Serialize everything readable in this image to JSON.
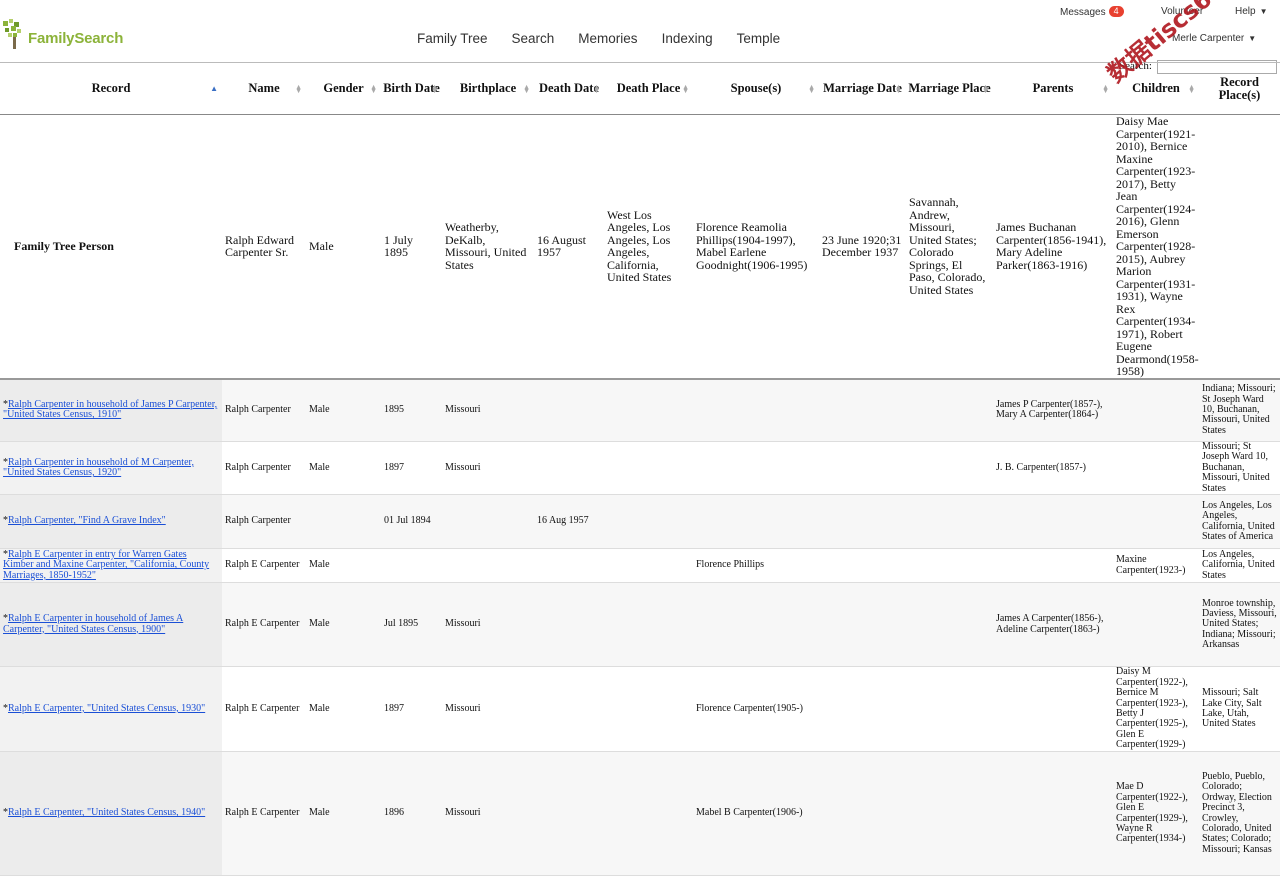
{
  "header": {
    "logo_text": "FamilySearch",
    "nav": [
      "Family Tree",
      "Search",
      "Memories",
      "Indexing",
      "Temple"
    ],
    "messages_label": "Messages",
    "messages_count": "4",
    "volunteer_label": "Volunteer",
    "help_label": "Help",
    "user_name": "Merle Carpenter",
    "search_label": "Search:",
    "search_value": ""
  },
  "watermark": "数据tiscs66",
  "columns": [
    "Record",
    "Name",
    "Gender",
    "Birth Date",
    "Birthplace",
    "Death Date",
    "Death Place",
    "Spouse(s)",
    "Marriage Date",
    "Marriage Place",
    "Parents",
    "Children",
    "Record Place(s)"
  ],
  "person": {
    "record": "Family Tree Person",
    "name": "Ralph Edward Carpenter Sr.",
    "gender": "Male",
    "birth_date": "1 July 1895",
    "birthplace": "Weatherby, DeKalb, Missouri, United States",
    "death_date": "16 August 1957",
    "death_place": "West Los Angeles, Los Angeles, Los Angeles, California, United States",
    "spouses": "Florence Reamolia Phillips(1904-1997), Mabel Earlene Goodnight(1906-1995)",
    "marriage_date": "23 June 1920;31 December 1937",
    "marriage_place": "Savannah, Andrew, Missouri, United States; Colorado Springs, El Paso, Colorado, United States",
    "parents": "James Buchanan Carpenter(1856-1941), Mary Adeline Parker(1863-1916)",
    "children": "Daisy Mae Carpenter(1921-2010), Bernice Maxine Carpenter(1923-2017), Betty Jean Carpenter(1924-2016), Glenn Emerson Carpenter(1928-2015), Aubrey Marion Carpenter(1931-1931), Wayne Rex Carpenter(1934-1971), Robert Eugene Dearmond(1958-1958)",
    "record_places": ""
  },
  "rows": [
    {
      "star": "*",
      "record": "Ralph Carpenter in household of James P Carpenter, \"United States Census, 1910\"",
      "name": "Ralph Carpenter",
      "gender": "Male",
      "birth_date": "1895",
      "birthplace": "Missouri",
      "death_date": "",
      "death_place": "",
      "spouses": "",
      "marriage_date": "",
      "marriage_place": "",
      "parents": "James P Carpenter(1857-), Mary A Carpenter(1864-)",
      "children": "",
      "record_places": "Indiana; Missouri; St Joseph Ward 10, Buchanan, Missouri, United States"
    },
    {
      "star": "*",
      "record": "Ralph Carpenter in household of M Carpenter, \"United States Census, 1920\"",
      "name": "Ralph Carpenter",
      "gender": "Male",
      "birth_date": "1897",
      "birthplace": "Missouri",
      "death_date": "",
      "death_place": "",
      "spouses": "",
      "marriage_date": "",
      "marriage_place": "",
      "parents": "J. B. Carpenter(1857-)",
      "children": "",
      "record_places": "Missouri; St Joseph Ward 10, Buchanan, Missouri, United States"
    },
    {
      "star": "*",
      "record": "Ralph Carpenter, \"Find A Grave Index\"",
      "name": "Ralph Carpenter",
      "gender": "",
      "birth_date": "01 Jul 1894",
      "birthplace": "",
      "death_date": "16 Aug 1957",
      "death_place": "",
      "spouses": "",
      "marriage_date": "",
      "marriage_place": "",
      "parents": "",
      "children": "",
      "record_places": "Los Angeles, Los Angeles, California, United States of America"
    },
    {
      "star": "*",
      "record": "Ralph E Carpenter in entry for Warren Gates Kimber and Maxine Carpenter, \"California, County Marriages, 1850-1952\"",
      "name": "Ralph E Carpenter",
      "gender": "Male",
      "birth_date": "",
      "birthplace": "",
      "death_date": "",
      "death_place": "",
      "spouses": "Florence Phillips",
      "marriage_date": "",
      "marriage_place": "",
      "parents": "",
      "children": "Maxine Carpenter(1923-)",
      "record_places": "Los Angeles, California, United States"
    },
    {
      "star": "*",
      "record": "Ralph E Carpenter in household of James A Carpenter, \"United States Census, 1900\"",
      "name": "Ralph E Carpenter",
      "gender": "Male",
      "birth_date": "Jul 1895",
      "birthplace": "Missouri",
      "death_date": "",
      "death_place": "",
      "spouses": "",
      "marriage_date": "",
      "marriage_place": "",
      "parents": "James A Carpenter(1856-), Adeline Carpenter(1863-)",
      "children": "",
      "record_places": "Monroe township, Daviess, Missouri, United States; Indiana; Missouri; Arkansas"
    },
    {
      "star": "*",
      "record": "Ralph E Carpenter, \"United States Census, 1930\"",
      "name": "Ralph E Carpenter",
      "gender": "Male",
      "birth_date": "1897",
      "birthplace": "Missouri",
      "death_date": "",
      "death_place": "",
      "spouses": "Florence Carpenter(1905-)",
      "marriage_date": "",
      "marriage_place": "",
      "parents": "",
      "children": "Daisy M Carpenter(1922-), Bernice M Carpenter(1923-), Betty J Carpenter(1925-), Glen E Carpenter(1929-)",
      "record_places": "Missouri; Salt Lake City, Salt Lake, Utah, United States"
    },
    {
      "star": "*",
      "record": "Ralph E Carpenter, \"United States Census, 1940\"",
      "name": "Ralph E Carpenter",
      "gender": "Male",
      "birth_date": "1896",
      "birthplace": "Missouri",
      "death_date": "",
      "death_place": "",
      "spouses": "Mabel B Carpenter(1906-)",
      "marriage_date": "",
      "marriage_place": "",
      "parents": "",
      "children": "Mae D Carpenter(1922-), Glen E Carpenter(1929-), Wayne R Carpenter(1934-)",
      "record_places": "Pueblo, Pueblo, Colorado; Ordway, Election Precinct 3, Crowley, Colorado, United States; Colorado; Missouri; Kansas"
    }
  ]
}
